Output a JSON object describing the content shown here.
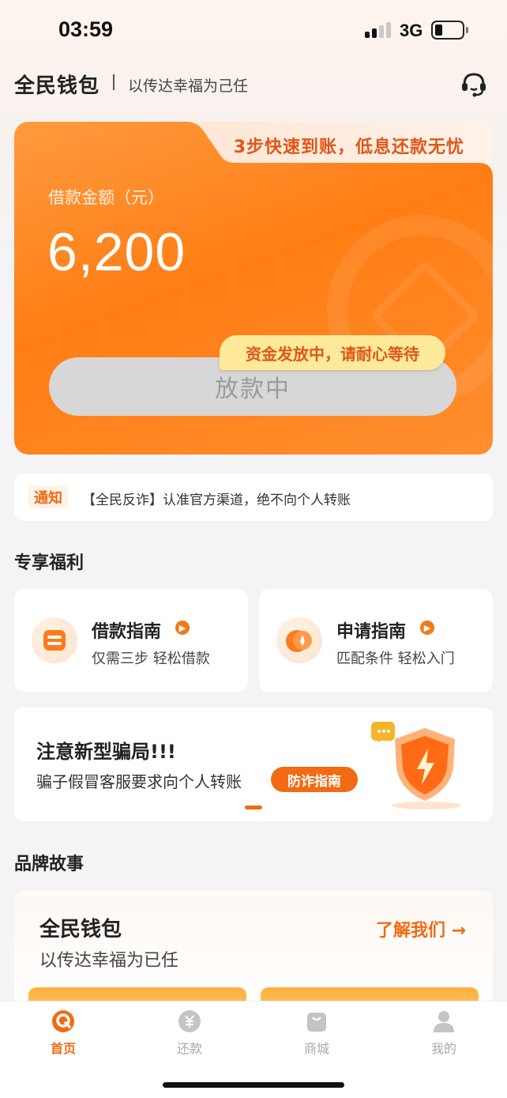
{
  "status_bar": {
    "time": "03:59",
    "network": "3G"
  },
  "header": {
    "brand": "全民钱包",
    "slogan": "以传达幸福为己任",
    "service_icon": "customer-service-icon"
  },
  "loan_card": {
    "tagline": "3步快速到账，低息还款无忧",
    "amount_label": "借款金额（元）",
    "amount": "6,200",
    "status_button": "放款中",
    "tooltip": "资金发放中，请耐心等待"
  },
  "notice": {
    "tag": "通知",
    "text": "【全民反诈】认准官方渠道，绝不向个人转账"
  },
  "benefits": {
    "title": "专享福利",
    "items": [
      {
        "title": "借款指南",
        "subtitle": "仅需三步 轻松借款",
        "icon": "guide-card-icon"
      },
      {
        "title": "申请指南",
        "subtitle": "匹配条件 轻松入门",
        "icon": "compass-icon"
      }
    ]
  },
  "fraud_banner": {
    "title": "注意新型骗局!!!",
    "subtitle": "骗子假冒客服要求向个人转账",
    "button": "防诈指南",
    "icon": "shield-lightning-icon"
  },
  "brand_story": {
    "title": "品牌故事",
    "name": "全民钱包",
    "slogan": "以传达幸福为已任",
    "link": "了解我们 →"
  },
  "tabbar": {
    "items": [
      {
        "label": "首页",
        "icon": "home-icon",
        "active": true
      },
      {
        "label": "还款",
        "icon": "yen-icon",
        "active": false
      },
      {
        "label": "商城",
        "icon": "shop-bag-icon",
        "active": false
      },
      {
        "label": "我的",
        "icon": "user-icon",
        "active": false
      }
    ]
  },
  "colors": {
    "accent": "#f26a12",
    "card_orange": "#ff7d14",
    "tooltip_yellow": "#ffe99a"
  }
}
